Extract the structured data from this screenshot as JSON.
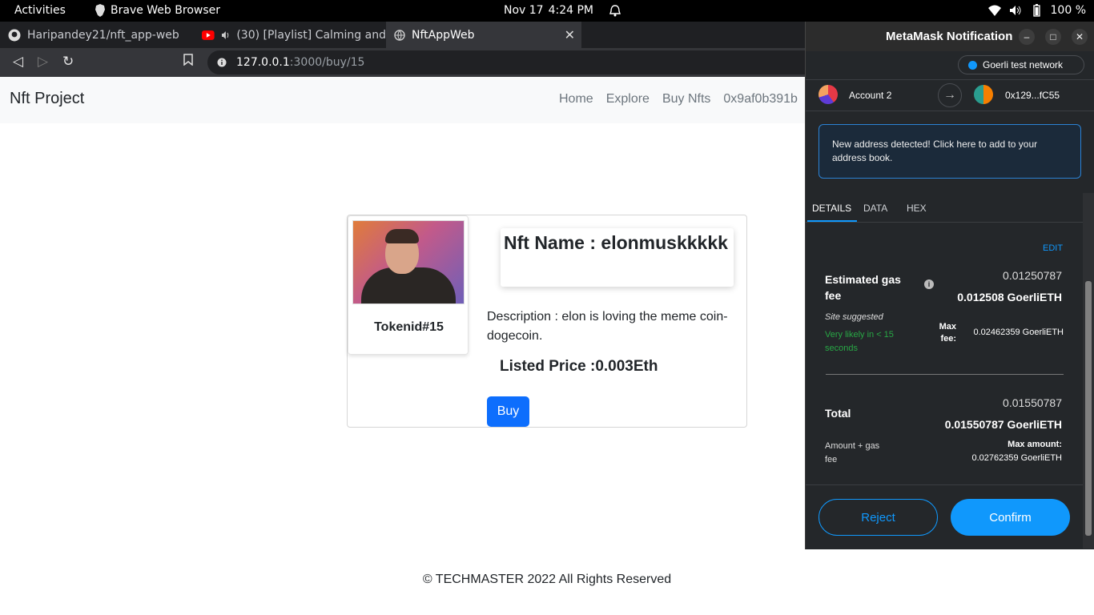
{
  "system_bar": {
    "activities": "Activities",
    "app_name": "Brave Web Browser",
    "date": "Nov 17",
    "time": "4:24 PM",
    "battery": "100 %"
  },
  "browser": {
    "tabs": [
      {
        "title": "Haripandey21/nft_app-web",
        "icon": "github-icon"
      },
      {
        "title": "(30) [Playlist] Calming and",
        "icon": "youtube-icon"
      },
      {
        "title": "NftAppWeb",
        "icon": "globe-icon"
      }
    ],
    "url_host": "127.0.0.1",
    "url_rest": ":3000/buy/15"
  },
  "site": {
    "brand": "Nft Project",
    "nav": [
      "Home",
      "Explore",
      "Buy Nfts",
      "0x9af0b391b"
    ],
    "token_id": "Tokenid#15",
    "nft_name": "Nft Name : elonmuskkkkk",
    "description": "Description : elon is loving the meme coin-dogecoin.",
    "price": "Listed Price :0.003Eth",
    "buy_label": "Buy",
    "footer": "© TECHMASTER 2022 All Rights Reserved"
  },
  "metamask": {
    "window_title": "MetaMask Notification",
    "network": "Goerli test network",
    "from_account": "Account 2",
    "to_address": "0x129...fC55",
    "notice": "New address detected! Click here to add to your address book.",
    "tabs": [
      "DETAILS",
      "DATA",
      "HEX"
    ],
    "edit": "EDIT",
    "gas_label": "Estimated gas fee",
    "gas_value": "0.01250787",
    "gas_value_bold": "0.012508 GoerliETH",
    "site_suggested": "Site suggested",
    "likely": "Very likely in < 15 seconds",
    "max_fee_label": "Max fee:",
    "max_fee_value": "0.02462359 GoerliETH",
    "total_label": "Total",
    "total_value": "0.01550787",
    "total_value_bold": "0.01550787 GoerliETH",
    "amount_gas": "Amount + gas fee",
    "max_amount_label": "Max amount:",
    "max_amount_value": "0.02762359 GoerliETH",
    "reject_label": "Reject",
    "confirm_label": "Confirm",
    "accent": "#1098fc"
  }
}
